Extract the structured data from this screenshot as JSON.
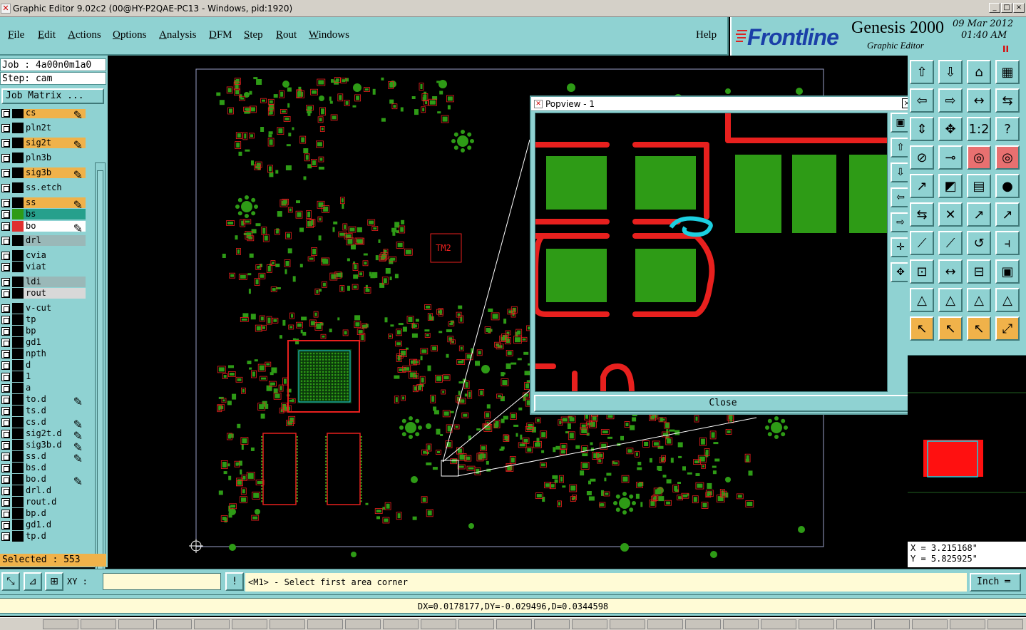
{
  "window": {
    "title": "Graphic Editor 9.02c2 (00@HY-P2QAE-PC13 - Windows, pid:1920)",
    "controls": [
      "_",
      "□",
      "×"
    ]
  },
  "menu": {
    "items": [
      {
        "first": "F",
        "rest": "ile"
      },
      {
        "first": "E",
        "rest": "dit"
      },
      {
        "first": "A",
        "rest": "ctions"
      },
      {
        "first": "O",
        "rest": "ptions"
      },
      {
        "first": "A",
        "rest": "nalysis"
      },
      {
        "first": "D",
        "rest": "FM"
      },
      {
        "first": "S",
        "rest": "tep"
      },
      {
        "first": "R",
        "rest": "out"
      },
      {
        "first": "W",
        "rest": "indows"
      }
    ],
    "help": "Help"
  },
  "brand": {
    "logo": "Frontline",
    "product": "Genesis 2000",
    "subtitle": "Graphic Editor",
    "date": "09 Mar 2012",
    "time": "01:40 AM",
    "pause": "II"
  },
  "job": {
    "job_line": "Job : 4a00n0m1a0",
    "step_line": "Step: cam",
    "matrix_button": "Job Matrix ..."
  },
  "layers": [
    {
      "name": "cs",
      "color": "#f0b24a",
      "edit": true
    },
    {
      "name": "pln2t",
      "color": "#8fd2d2",
      "edit": false
    },
    {
      "name": "sig2t",
      "color": "#f0b24a",
      "edit": true
    },
    {
      "name": "pln3b",
      "color": "#8fd2d2",
      "edit": false
    },
    {
      "name": "sig3b",
      "color": "#f0b24a",
      "edit": true
    },
    {
      "name": "ss.etch",
      "color": "#8fd2d2",
      "edit": false
    },
    {
      "name": "ss",
      "color": "#f0b24a",
      "edit": true
    },
    {
      "name": "bs",
      "color": "#26a08c",
      "edit": false
    },
    {
      "name": "bo",
      "color": "#ffffff",
      "edit": true
    },
    {
      "name": "drl",
      "color": "#9ab8b8",
      "edit": false
    },
    {
      "name": "cvia",
      "color": "#8fd2d2",
      "edit": false
    },
    {
      "name": "viat",
      "color": "#8fd2d2",
      "edit": false
    },
    {
      "name": "ldi",
      "color": "#9ab8b8",
      "edit": false
    },
    {
      "name": "rout",
      "color": "#d8d8d8",
      "edit": false
    },
    {
      "name": "v-cut",
      "color": "#8fd2d2",
      "edit": false
    },
    {
      "name": "tp",
      "color": "#8fd2d2",
      "edit": false
    },
    {
      "name": "bp",
      "color": "#8fd2d2",
      "edit": false
    },
    {
      "name": "gd1",
      "color": "#8fd2d2",
      "edit": false
    },
    {
      "name": "npth",
      "color": "#8fd2d2",
      "edit": false
    },
    {
      "name": "d",
      "color": "#8fd2d2",
      "edit": false
    },
    {
      "name": "1",
      "color": "#8fd2d2",
      "edit": false
    },
    {
      "name": "a",
      "color": "#8fd2d2",
      "edit": false
    },
    {
      "name": "to.d",
      "color": "#8fd2d2",
      "edit": true
    },
    {
      "name": "ts.d",
      "color": "#8fd2d2",
      "edit": false
    },
    {
      "name": "cs.d",
      "color": "#8fd2d2",
      "edit": true
    },
    {
      "name": "sig2t.d",
      "color": "#8fd2d2",
      "edit": true
    },
    {
      "name": "sig3b.d",
      "color": "#8fd2d2",
      "edit": true
    },
    {
      "name": "ss.d",
      "color": "#8fd2d2",
      "edit": true
    },
    {
      "name": "bs.d",
      "color": "#8fd2d2",
      "edit": false
    },
    {
      "name": "bo.d",
      "color": "#8fd2d2",
      "edit": true
    },
    {
      "name": "drl.d",
      "color": "#8fd2d2",
      "edit": false
    },
    {
      "name": "rout.d",
      "color": "#8fd2d2",
      "edit": false
    },
    {
      "name": "bp.d",
      "color": "#8fd2d2",
      "edit": false
    },
    {
      "name": "gd1.d",
      "color": "#8fd2d2",
      "edit": false
    },
    {
      "name": "tp.d",
      "color": "#8fd2d2",
      "edit": false
    }
  ],
  "selected": "Selected : 553",
  "board_labels": {
    "tm2": "TM2"
  },
  "popview": {
    "title": "Popview - 1",
    "close_label": "Close"
  },
  "coords": {
    "x": "X = 3.215168\"",
    "y": "Y = 5.825925\""
  },
  "bottom": {
    "xy_label": "XY :",
    "xy_value": "",
    "prompt": "<M1> - Select first area corner",
    "unit": "Inch"
  },
  "measure": "DX=0.0178177,DY=-0.029496,D=0.0344598",
  "colors": {
    "panel": "#8fd2d2",
    "board_copper": "#e8201e",
    "board_pads": "#2e9b16",
    "highlight": "#1ccfe0",
    "accent_orange": "#f0b24a"
  }
}
